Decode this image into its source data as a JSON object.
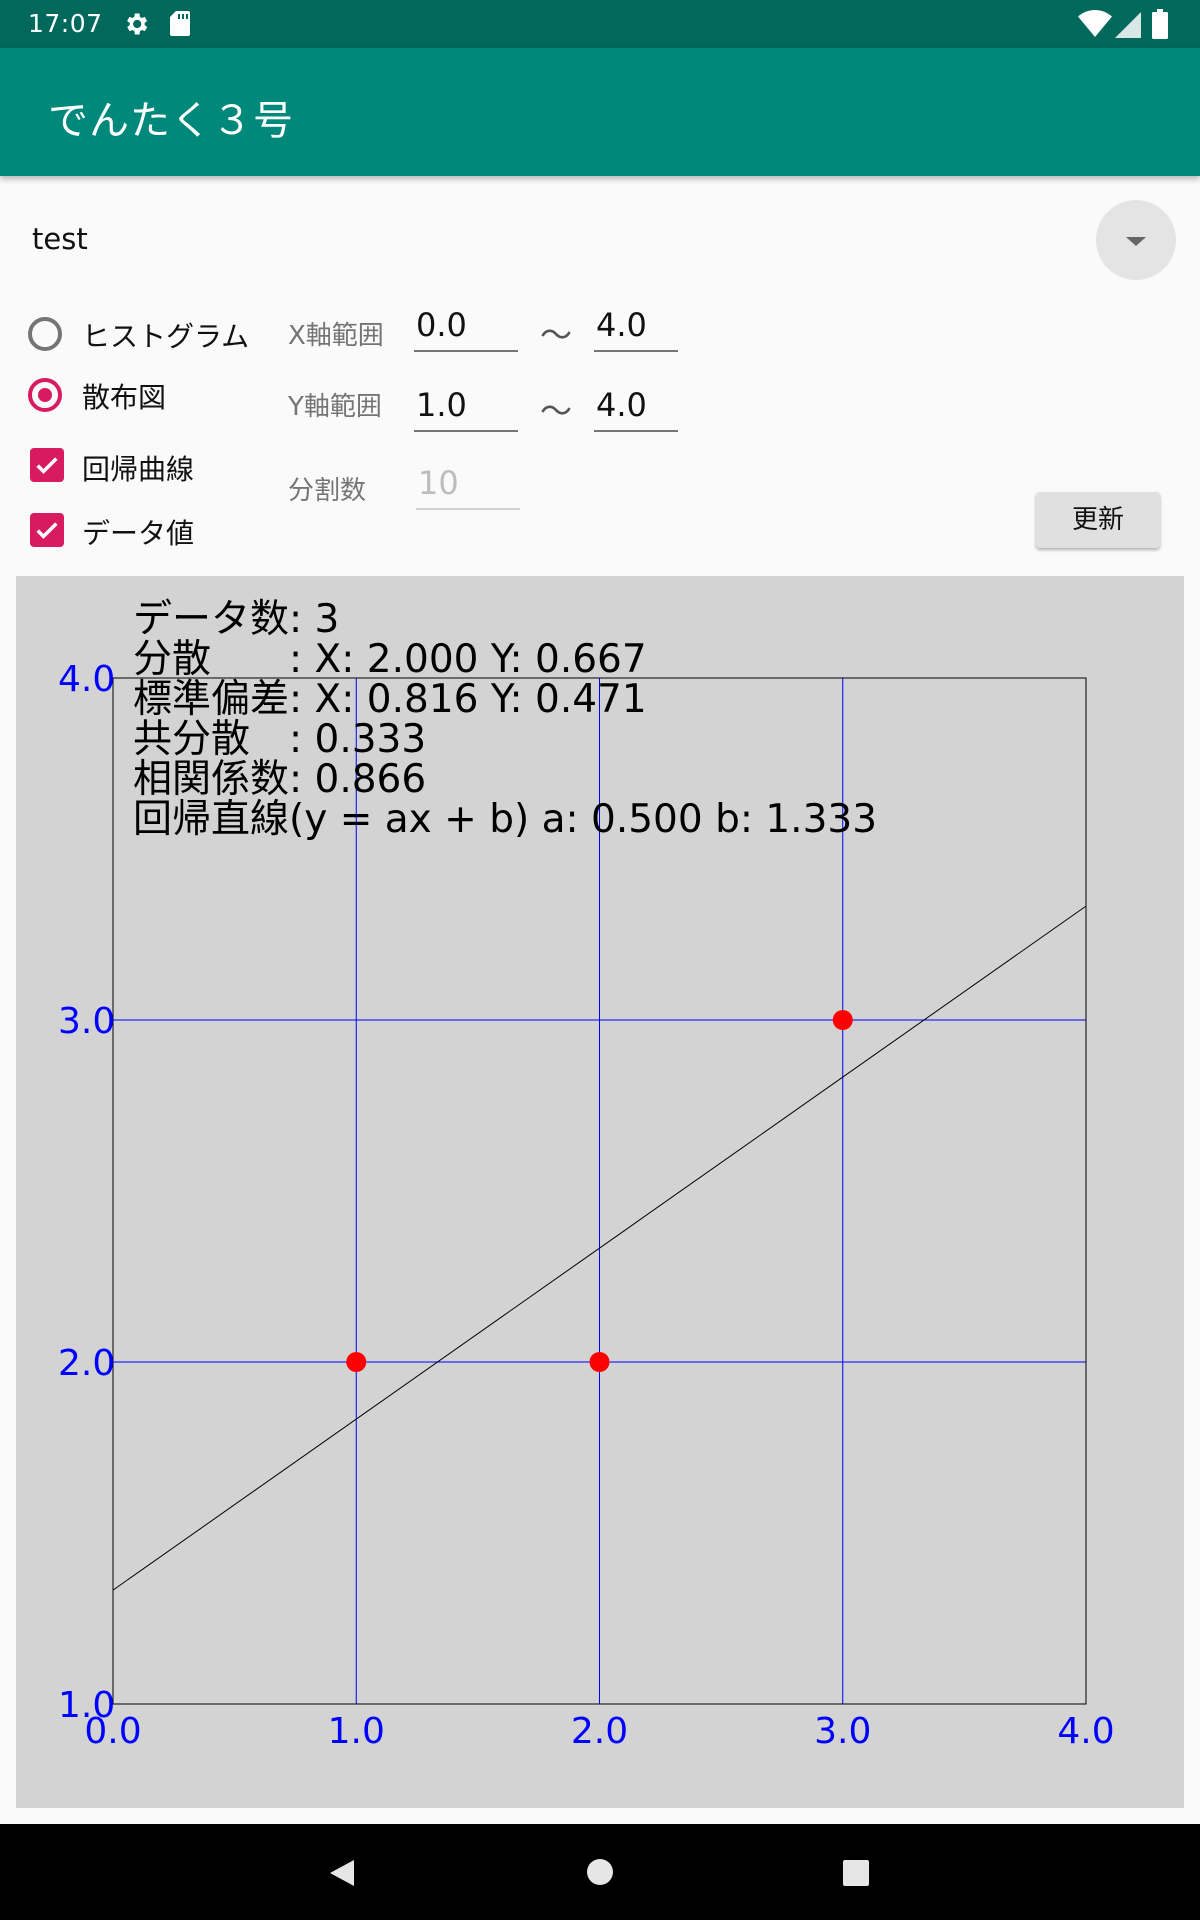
{
  "status_bar": {
    "time": "17:07",
    "icons": [
      "gear-icon",
      "sd-card-icon",
      "wifi-icon",
      "signal-icon",
      "battery-icon"
    ]
  },
  "app_bar": {
    "title": "でんたく３号",
    "color": "#00897b"
  },
  "dataset_selector": {
    "selected": "test"
  },
  "chart_type": {
    "options": [
      {
        "label": "ヒストグラム",
        "checked": false
      },
      {
        "label": "散布図",
        "checked": true
      }
    ]
  },
  "options": {
    "regression_curve": {
      "label": "回帰曲線",
      "checked": true
    },
    "data_values": {
      "label": "データ値",
      "checked": true
    }
  },
  "ranges": {
    "x_label": "X軸範囲",
    "x_min": "0.0",
    "x_max": "4.0",
    "y_label": "Y軸範囲",
    "y_min": "1.0",
    "y_max": "4.0",
    "separator": "～",
    "divisions_label": "分割数",
    "divisions_placeholder": "10"
  },
  "update_button": {
    "label": "更新"
  },
  "stats": {
    "line1": "データ数: 3",
    "line2": "分散　　: X: 2.000  Y: 0.667",
    "line3": "標準偏差: X: 0.816  Y: 0.471",
    "line4": "共分散　: 0.333",
    "line5": "相関係数: 0.866",
    "line6": "回帰直線(y = ax + b) a: 0.500  b: 1.333"
  },
  "chart_data": {
    "type": "scatter",
    "points": [
      {
        "x": 1.0,
        "y": 2.0
      },
      {
        "x": 2.0,
        "y": 2.0
      },
      {
        "x": 3.0,
        "y": 3.0
      }
    ],
    "regression": {
      "a": 0.5,
      "b": 1.333
    },
    "xlim": [
      0.0,
      4.0
    ],
    "ylim": [
      1.0,
      4.0
    ],
    "x_ticks": [
      "0.0",
      "1.0",
      "2.0",
      "3.0",
      "4.0"
    ],
    "y_ticks": [
      "1.0",
      "2.0",
      "3.0",
      "4.0"
    ],
    "grid": true,
    "colors": {
      "points": "#ff0000",
      "grid": "#0000ff",
      "ticks": "#0000ff",
      "line": "#000000",
      "background": "#d3d3d3"
    }
  }
}
